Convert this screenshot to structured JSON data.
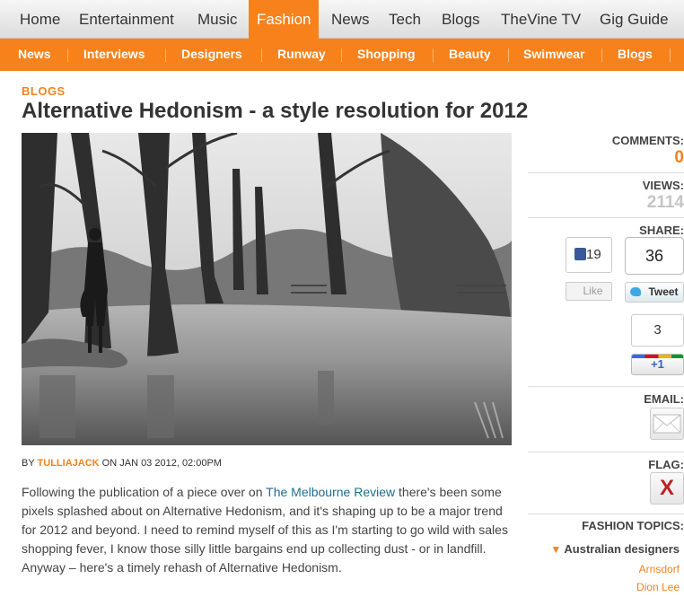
{
  "topnav": {
    "items": [
      {
        "label": "Home"
      },
      {
        "label": "Entertainment"
      },
      {
        "label": "Music"
      },
      {
        "label": "Fashion"
      },
      {
        "label": "News"
      },
      {
        "label": "Tech"
      },
      {
        "label": "Blogs"
      },
      {
        "label": "TheVine TV"
      },
      {
        "label": "Gig Guide"
      }
    ],
    "active": "Fashion"
  },
  "subnav": {
    "items": [
      {
        "label": "News"
      },
      {
        "label": "Interviews"
      },
      {
        "label": "Designers"
      },
      {
        "label": "Runway"
      },
      {
        "label": "Shopping"
      },
      {
        "label": "Beauty"
      },
      {
        "label": "Swimwear"
      },
      {
        "label": "Blogs"
      }
    ]
  },
  "article": {
    "category": "BLOGS",
    "title": "Alternative Hedonism - a style resolution for 2012",
    "byline_prefix": "BY",
    "author": "TULLIAJACK",
    "byline_date": "ON JAN 03 2012, 02:00PM",
    "body_before_link": "Following the publication of a piece over on",
    "body_link": "The Melbourne Review",
    "body_after_link": "there's been some pixels splashed about on Alternative Hedonism, and it's shaping up to be a major trend for 2012 and beyond. I need to remind myself of this as I'm starting to go wild with sales shopping fever, I know those silly little bargains end up collecting dust  - or in landfill. Anyway – here's a timely rehash of Alternative Hedonism."
  },
  "sidebar": {
    "comments_label": "COMMENTS:",
    "comments_value": "0",
    "views_label": "VIEWS:",
    "views_value": "2114",
    "share_label": "SHARE:",
    "facebook_count": "19",
    "facebook_like": "Like",
    "twitter_count": "36",
    "twitter_button": "Tweet",
    "gplus_count": "3",
    "gplus_button": "+1",
    "email_label": "EMAIL:",
    "flag_label": "FLAG:",
    "flag_glyph": "X",
    "topics_label": "FASHION TOPICS:",
    "topic_main": "Australian designers",
    "topics": [
      "Arnsdorf",
      "Dion Lee"
    ]
  },
  "colors": {
    "accent": "#f7821b",
    "link": "#1f6e8c",
    "text": "#333333"
  },
  "icons": [
    "facebook-thumb-icon",
    "twitter-bird-icon",
    "email-envelope-icon",
    "flag-x-icon",
    "triangle-down-icon"
  ]
}
